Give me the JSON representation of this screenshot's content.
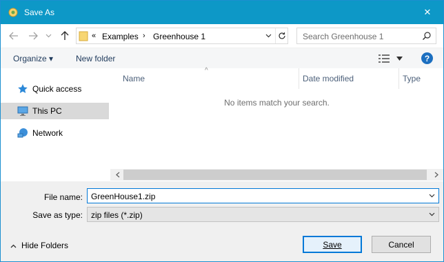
{
  "window": {
    "title": "Save As",
    "close_glyph": "✕"
  },
  "address": {
    "overflow": "«",
    "crumbs": [
      "Examples",
      "Greenhouse 1"
    ]
  },
  "search": {
    "placeholder": "Search Greenhouse 1"
  },
  "toolbar": {
    "organize_label": "Organize ▾",
    "new_folder_label": "New folder",
    "help_label": "?"
  },
  "nav_pane": {
    "items": [
      {
        "label": "Quick access",
        "icon": "star-icon"
      },
      {
        "label": "This PC",
        "icon": "computer-icon",
        "selected": true
      },
      {
        "label": "Network",
        "icon": "network-icon"
      }
    ]
  },
  "file_list": {
    "columns": [
      "Name",
      "Date modified",
      "Type"
    ],
    "empty_message": "No items match your search."
  },
  "form": {
    "file_name_label": "File name:",
    "file_name_value": "GreenHouse1.zip",
    "save_type_label": "Save as type:",
    "save_type_value": "zip files (*.zip)"
  },
  "footer": {
    "hide_folders_label": "Hide Folders",
    "save_label": "Save",
    "cancel_label": "Cancel"
  },
  "colors": {
    "title_bar": "#0d98c7",
    "accent": "#0078d7",
    "help": "#1c6fc0"
  }
}
